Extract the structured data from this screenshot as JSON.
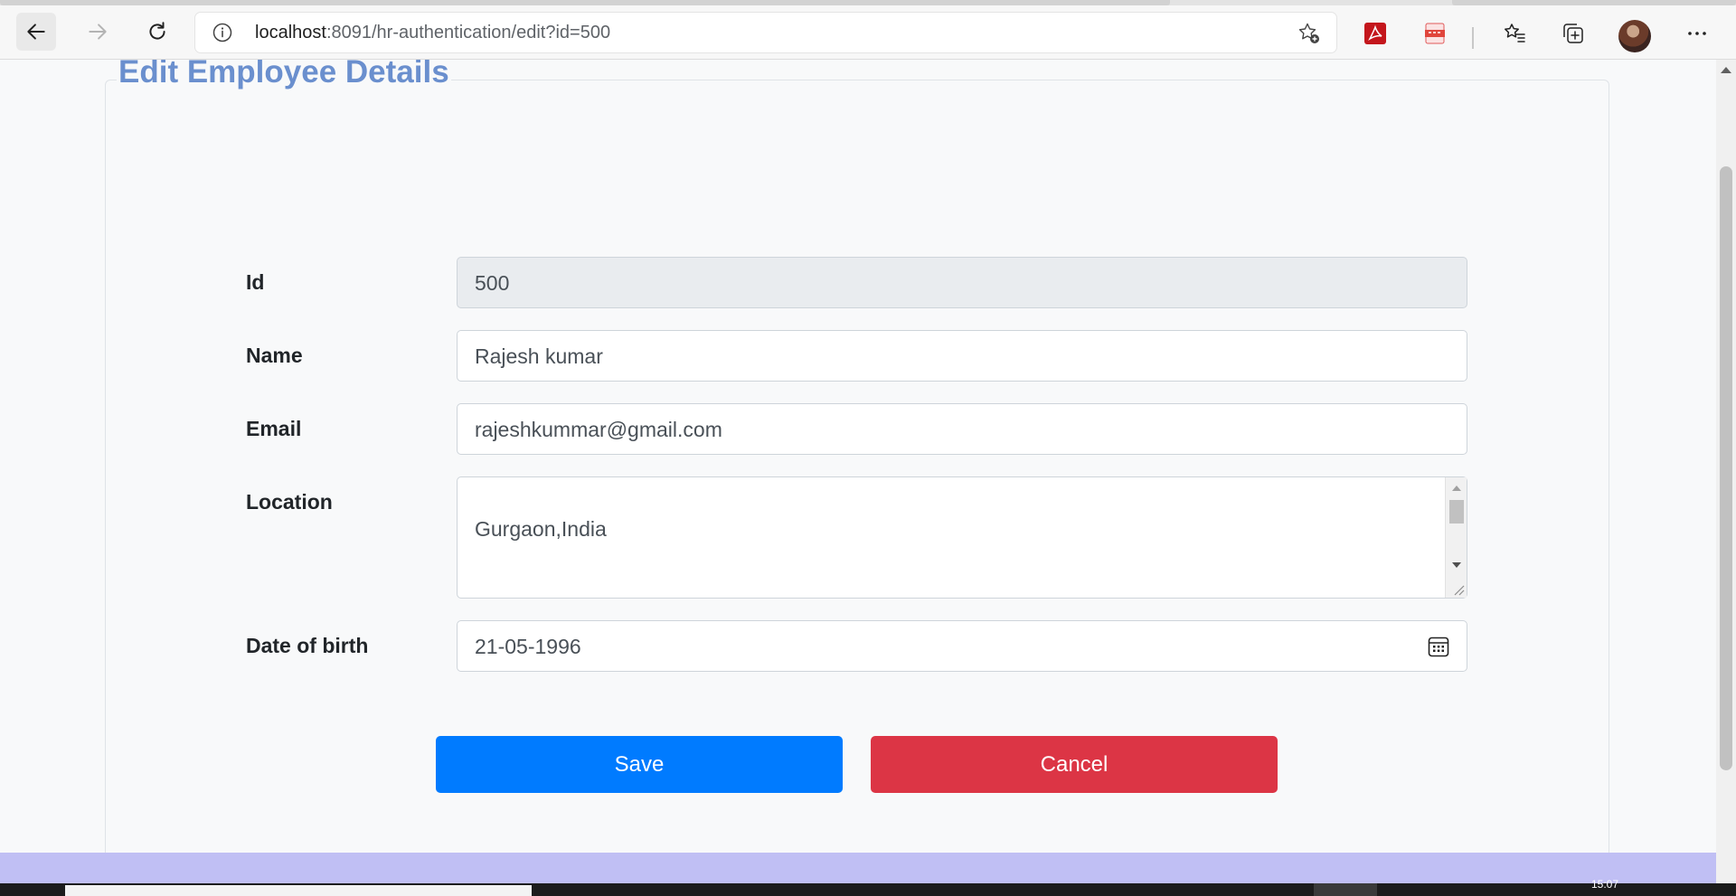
{
  "browser": {
    "url_host": "localhost",
    "url_path": ":8091/hr-authentication/edit?id=500"
  },
  "page": {
    "title": "Edit Employee Details"
  },
  "form": {
    "id": {
      "label": "Id",
      "value": "500"
    },
    "name": {
      "label": "Name",
      "value": "Rajesh kumar"
    },
    "email": {
      "label": "Email",
      "value": "rajeshkummar@gmail.com"
    },
    "location": {
      "label": "Location",
      "value": "Gurgaon,India"
    },
    "dob": {
      "label": "Date of birth",
      "value": "21-05-1996"
    }
  },
  "buttons": {
    "save": "Save",
    "cancel": "Cancel"
  },
  "colors": {
    "title": "#6a8fce",
    "save": "#007bff",
    "cancel": "#dc3545",
    "footer": "#c0bff4"
  },
  "taskbar": {
    "clock": "15:07"
  }
}
